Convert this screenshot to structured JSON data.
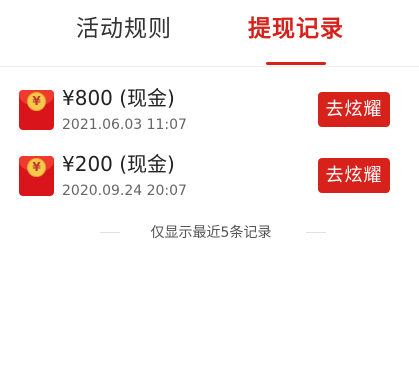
{
  "tabs": [
    {
      "label": "活动规则",
      "active": false
    },
    {
      "label": "提现记录",
      "active": true
    }
  ],
  "records": [
    {
      "amount": "¥800 (现金)",
      "time": "2021.06.03 11:07",
      "button_label": "去炫耀"
    },
    {
      "amount": "¥200 (现金)",
      "time": "2020.09.24 20:07",
      "button_label": "去炫耀"
    }
  ],
  "envelope_icon": {
    "name": "red-envelope-icon",
    "glyph": "¥"
  },
  "footer_note": "仅显示最近5条记录",
  "colors": {
    "accent": "#d7211b",
    "text": "#222222",
    "secondary_text": "#666666"
  }
}
